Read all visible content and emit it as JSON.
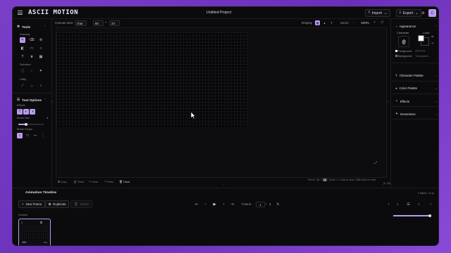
{
  "header": {
    "logo": "ASCII MOTION",
    "title": "Untitled Project",
    "import_label": "Import",
    "export_label": "Export"
  },
  "left_panel": {
    "tools_title": "Tools",
    "drawing_label": "Drawing",
    "selection_label": "Selection",
    "utility_label": "Utility",
    "tool_options_title": "Tool Options",
    "effects_label": "Effects",
    "brush_size_label": "Brush Size",
    "brush_size_value": "1",
    "brush_size_fraction": 0.3,
    "brush_shape_label": "Brush Shape"
  },
  "canvas_bar": {
    "canvas_size_label": "Canvas size:",
    "mode_value": "char",
    "width_value": "80",
    "times": "×",
    "height_value": "24",
    "display_label": "Display",
    "zoom_label": "Zoom",
    "zoom_value": "100%",
    "minus": "-",
    "plus": "+"
  },
  "canvas_bottom": {
    "copy": "Copy",
    "paste": "Paste",
    "undo": "Undo",
    "redo": "Redo",
    "clear": "Clear",
    "status": "Pencil: \"@\"  T  ██  • Circle: 1 • Click to draw, Shift+click for lines",
    "coords": "[0, 30]"
  },
  "right_panel": {
    "appearance_title": "Appearance",
    "character_label": "Character",
    "color_label": "Color",
    "character_value": "@",
    "foreground_label": "Foreground:",
    "foreground_value": "#FFFFFF",
    "background_label": "Background:",
    "background_value": "Transparent",
    "sections": [
      "Character Palette",
      "Color Palette",
      "Effects",
      "Generators"
    ],
    "colors": {
      "foreground": "#ffffff",
      "background": "transparent",
      "accent": "#b99bf0"
    }
  },
  "timeline": {
    "title": "Animation Timeline",
    "frame_count_label": "1 frame • 0.1s",
    "new_frame_label": "New Frame",
    "duplicate_label": "Duplicate",
    "delete_label": "Delete",
    "frame_label": "Frame:",
    "frame_current": "1",
    "frame_sep": "/",
    "frame_total": "1",
    "frames_section_label": "Frames",
    "frame_card_duration": "100",
    "frame_card_unit": "ms",
    "frame_card_number": "1",
    "onion_value": "1",
    "slider_fraction": 0.95
  }
}
